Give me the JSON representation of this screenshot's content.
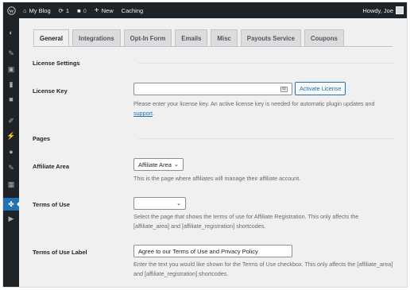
{
  "admin_bar": {
    "site_name": "My Blog",
    "updates_count": "1",
    "comments_count": "0",
    "new_label": "New",
    "caching_label": "Caching",
    "greeting": "Howdy, Joe"
  },
  "tabs": [
    {
      "label": "General"
    },
    {
      "label": "Integrations"
    },
    {
      "label": "Opt-In Form"
    },
    {
      "label": "Emails"
    },
    {
      "label": "Misc"
    },
    {
      "label": "Payouts Service"
    },
    {
      "label": "Coupons"
    }
  ],
  "license": {
    "section_title": "License Settings",
    "field_label": "License Key",
    "input_value": "",
    "activate_button": "Activate License",
    "description_text": "Please enter your license key. An active license key is needed for automatic plugin updates and",
    "support_link": "support",
    "description_end": "."
  },
  "pages": {
    "section_title": "Pages",
    "affiliate_area": {
      "label": "Affiliate Area",
      "selected": "Affiliate Area",
      "description": "This is the page where affiliates will manage their affiliate account."
    },
    "terms_of_use": {
      "label": "Terms of Use",
      "selected": "",
      "description": "Select the page that shows the terms of use for Affiliate Registration. This only affects the [affiliate_area] and [affiliate_registration] shortcodes."
    },
    "terms_of_use_label": {
      "label": "Terms of Use Label",
      "value": "Agree to our Terms of Use and Privacy Policy",
      "description": "Enter the text you would like shown for the Terms of Use checkbox. This only affects the [affiliate_area] and [affiliate_registration] shortcodes."
    }
  },
  "colors": {
    "admin_bar": "#1d2327",
    "accent": "#2271b1",
    "background": "#f0f0f1"
  },
  "icons": [
    "wordpress-logo-icon",
    "home-icon",
    "updates-icon",
    "comments-icon",
    "plus-icon",
    "dashboard-icon",
    "pin-icon",
    "media-icon",
    "pages-icon",
    "comments-menu-icon",
    "appearance-icon",
    "plugins-icon",
    "users-icon",
    "tools-icon",
    "settings-icon",
    "affiliatewp-icon",
    "play-icon"
  ]
}
